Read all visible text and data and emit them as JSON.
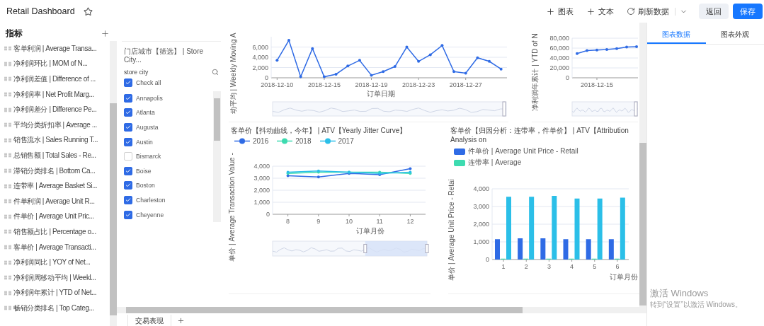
{
  "header": {
    "title": "Retail Dashboard",
    "actions": [
      {
        "kind": "add",
        "label": "图表"
      },
      {
        "kind": "add",
        "label": "文本"
      },
      {
        "kind": "refresh",
        "label": "刷新数据"
      }
    ],
    "buttons": [
      {
        "kind": "secondary",
        "label": "返回"
      },
      {
        "kind": "primary",
        "label": "保存"
      }
    ]
  },
  "sidebar": {
    "title": "指标",
    "items": [
      "客单利润 | Average Transa...",
      "净利润环比 | MOM of N...",
      "净利润差值 | Difference of ...",
      "净利润率 | Net Profit Marg...",
      "净利润差分 | Difference Pe...",
      "平均分类折扣率 | Average ...",
      "销售流水 | Sales Running T...",
      "总销售额 | Total Sales - Re...",
      "滞销分类排名 | Bottom Ca...",
      "连带率 | Average Basket Si...",
      "件单利润 | Average Unit R...",
      "件单价 | Average Unit Pric...",
      "销售额占比 | Percentage o...",
      "客单价 | Average Transacti...",
      "净利润同比 | YOY of Net...",
      "净利润周移动平均 | Weekl...",
      "净利润年累计 | YTD of Net...",
      "畅销分类排名 | Top Categ..."
    ]
  },
  "filter": {
    "title": "门店城市【筛选】 | Store City...",
    "field_label": "store city",
    "options": [
      {
        "label": "Check all",
        "checked": true
      },
      {
        "label": "Annapolis",
        "checked": true
      },
      {
        "label": "Atlanta",
        "checked": true
      },
      {
        "label": "Augusta",
        "checked": true
      },
      {
        "label": "Austin",
        "checked": true
      },
      {
        "label": "Bismarck",
        "checked": false
      },
      {
        "label": "Boise",
        "checked": true
      },
      {
        "label": "Boston",
        "checked": true
      },
      {
        "label": "Charleston",
        "checked": true
      },
      {
        "label": "Cheyenne",
        "checked": true
      }
    ]
  },
  "charts": [
    {
      "chart_data": {
        "type": "line",
        "grid": true,
        "xlabel": "订单日期",
        "ylabel": "动平均 | Weekly Moving A",
        "ylim": [
          0,
          8000
        ],
        "categories": [
          "2018-12-10",
          null,
          null,
          null,
          "2018-12-15",
          null,
          null,
          null,
          "2018-12-19",
          null,
          null,
          null,
          "2018-12-23",
          null,
          null,
          null,
          "2018-12-27",
          null,
          null,
          null
        ],
        "yticks": [
          {
            "value": 0,
            "label": "0"
          },
          {
            "value": 2000,
            "label": "2,000"
          },
          {
            "value": 4000,
            "label": "4,000"
          },
          {
            "value": 6000,
            "label": "6,000"
          }
        ],
        "series": [
          {
            "color": "#2f6be5",
            "values": [
              3400,
              7300,
              200,
              5700,
              200,
              700,
              2300,
              3400,
              500,
              1200,
              2200,
              6000,
              3200,
              4500,
              6300,
              1200,
              900,
              3900,
              3200,
              1700
            ]
          }
        ]
      }
    },
    {
      "chart_data": {
        "type": "line",
        "grid": true,
        "ylabel": "净利润年累计 | YTD of N",
        "categories": [
          null,
          null,
          "2018-12-15",
          null,
          null,
          null,
          null
        ],
        "ylim": [
          0,
          80000
        ],
        "yticks": [
          {
            "value": 0,
            "label": "0"
          },
          {
            "value": 20000,
            "label": "20,000"
          },
          {
            "value": 40000,
            "label": "40,000"
          },
          {
            "value": 60000,
            "label": "60,000"
          },
          {
            "value": 80000,
            "label": "80,000"
          }
        ],
        "series": [
          {
            "color": "#2f6be5",
            "values": [
              49000,
              55000,
              56000,
              57000,
              59000,
              62000,
              63000
            ]
          }
        ]
      }
    },
    {
      "chart_data": {
        "type": "line",
        "grid": true,
        "title": "客单价【抖动曲线，今年】 | ATV【Yearly Jitter Curve】",
        "xlabel": "订单月份",
        "ylabel": "单价 | Average Transaction Value -",
        "categories": [
          "8",
          "9",
          "10",
          "11",
          "12"
        ],
        "ylim": [
          0,
          4000
        ],
        "yticks": [
          {
            "value": 0,
            "label": "0"
          },
          {
            "value": 1000,
            "label": "1,000"
          },
          {
            "value": 2000,
            "label": "2,000"
          },
          {
            "value": 3000,
            "label": "3,000"
          },
          {
            "value": 4000,
            "label": "4,000"
          }
        ],
        "series": [
          {
            "name": "2016",
            "color": "#2f6be5",
            "values": [
              3200,
              3100,
              3400,
              3300,
              3800
            ]
          },
          {
            "name": "2018",
            "color": "#3ddbb0",
            "values": [
              3400,
              3500,
              3500,
              3500,
              3400
            ]
          },
          {
            "name": "2017",
            "color": "#2bbfe8",
            "values": [
              3500,
              3600,
              3500,
              3400,
              3500
            ]
          }
        ]
      }
    },
    {
      "chart_data": {
        "type": "bar",
        "grid": true,
        "title": "客单价【归因分析：连带率，件单价】 | ATV【Attribution Analysis on",
        "xlabel": "订单月份",
        "ylabel": "单价 | Average Unit Price - Retai",
        "categories": [
          "1",
          "2",
          "3",
          "4",
          "5",
          "6"
        ],
        "ylim": [
          0,
          4000
        ],
        "yticks": [
          {
            "value": 0,
            "label": "0"
          },
          {
            "value": 1000,
            "label": "1,000"
          },
          {
            "value": 2000,
            "label": "2,000"
          },
          {
            "value": 3000,
            "label": "3,000"
          },
          {
            "value": 4000,
            "label": "4,000"
          }
        ],
        "series": [
          {
            "name": "件单价 | Average Unit Price - Retail",
            "color": "#2f6be5",
            "values": [
              1150,
              1200,
              1200,
              1150,
              1150,
              1150
            ]
          },
          {
            "name": "连带率 | Average",
            "color": "#3ddbb0",
            "values": [
              50,
              50,
              50,
              50,
              50,
              50
            ]
          },
          {
            "color": "#2bbfe8",
            "values": [
              3550,
              3550,
              3600,
              3450,
              3450,
              3500
            ]
          }
        ]
      }
    }
  ],
  "sheet_tabs": [
    "交易表现"
  ],
  "panel": {
    "tabs": [
      {
        "label": "图表数据",
        "selected": true
      },
      {
        "label": "图表外观",
        "selected": false
      }
    ]
  },
  "activation_notice": {
    "title": "激活 Windows",
    "text": "转到“设置”以激活 Windows。"
  }
}
